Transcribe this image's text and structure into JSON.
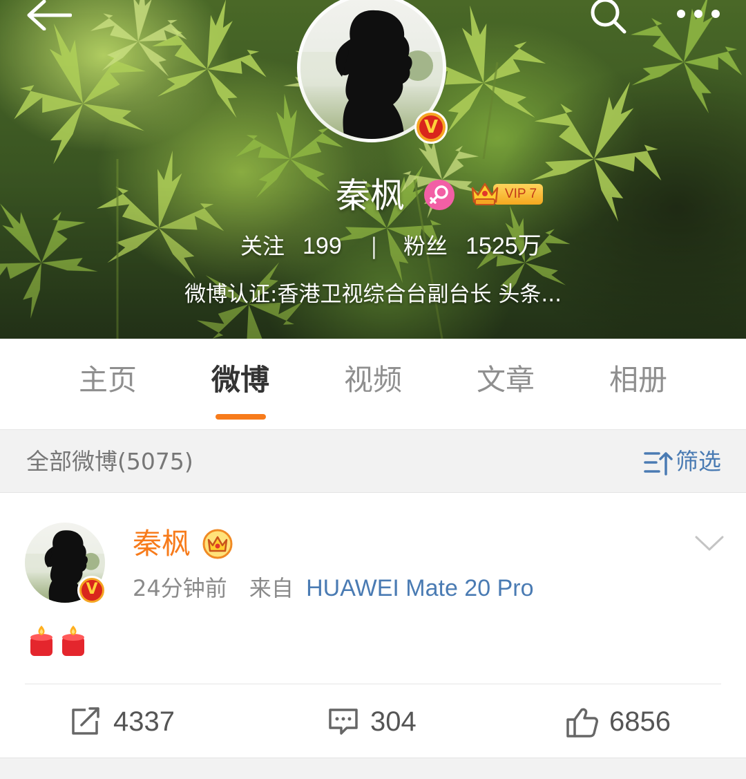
{
  "header": {
    "profile_name": "秦枫",
    "avatar_badge": "V",
    "vip_label": "VIP 7",
    "stats": {
      "following_label": "关注",
      "following_value": "199",
      "divider": "|",
      "fans_label": "粉丝",
      "fans_value": "1525万"
    },
    "verification": "微博认证:香港卫视综合台副台长 头条...",
    "icons": [
      "back-arrow-icon",
      "search-icon",
      "more-icon",
      "female-gender-icon",
      "vip-crown-icon"
    ]
  },
  "tabs": [
    {
      "label": "主页",
      "active": false
    },
    {
      "label": "微博",
      "active": true
    },
    {
      "label": "视频",
      "active": false
    },
    {
      "label": "文章",
      "active": false
    },
    {
      "label": "相册",
      "active": false
    }
  ],
  "filter_bar": {
    "title": "全部微博(5075)",
    "filter_label": "筛选"
  },
  "post": {
    "author": "秦枫",
    "avatar_badge": "V",
    "time": "24分钟前",
    "from_label": "来自",
    "source": "HUAWEI Mate 20 Pro",
    "content_emoji": [
      "candle-icon",
      "candle-icon"
    ],
    "actions": {
      "repost_count": "4337",
      "comment_count": "304",
      "like_count": "6856"
    }
  },
  "colors": {
    "accent_orange": "#f77b1b",
    "link_blue": "#4a7bb3",
    "verify_red": "#d9261c",
    "verify_gold": "#f5a623",
    "gender_pink": "#f25fa5"
  }
}
